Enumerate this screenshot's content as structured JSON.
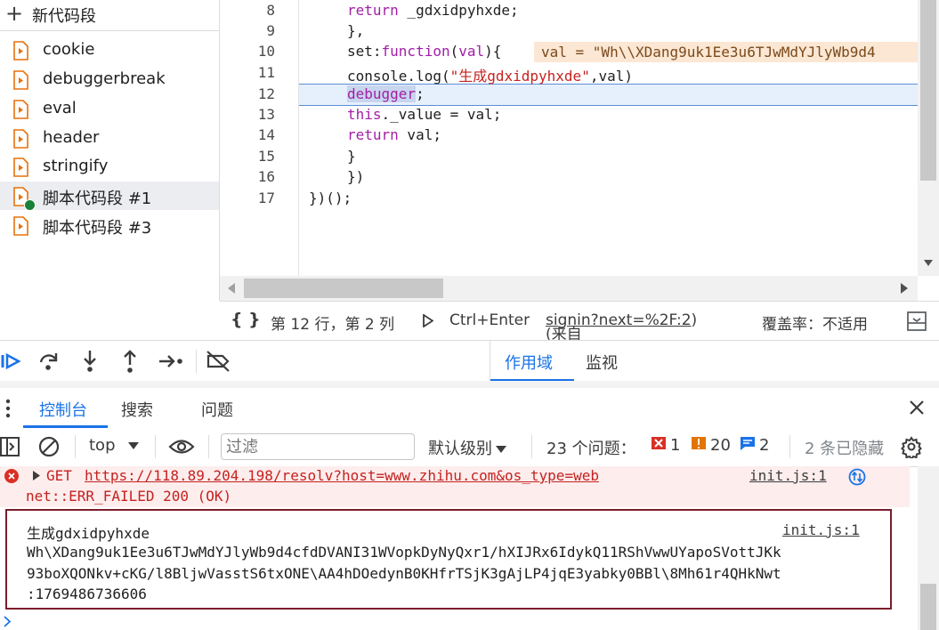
{
  "sidebar": {
    "new_snippet_label": "新代码段",
    "snippets": [
      {
        "label": "cookie"
      },
      {
        "label": "debuggerbreak"
      },
      {
        "label": "eval"
      },
      {
        "label": "header"
      },
      {
        "label": "stringify"
      },
      {
        "label": "脚本代码段 #1",
        "selected": true,
        "active_breakpoint": true
      },
      {
        "label": "脚本代码段 #3"
      }
    ]
  },
  "editor": {
    "line_numbers": [
      "8",
      "9",
      "10",
      "11",
      "12",
      "13",
      "14",
      "15",
      "16",
      "17"
    ],
    "lines": {
      "l8_kw": "return",
      "l8_rest": " _gdxidpyhxde;",
      "l9": "},",
      "l10_a": "set:",
      "l10_kw": "function",
      "l10_b": "(",
      "l10_param": "val",
      "l10_c": "){",
      "l10_inline": "val = \"Wh\\\\XDang9uk1Ee3u6TJwMdYJlyWb9d4",
      "l11_a": "console.log(",
      "l11_str": "\"生成gdxidpyhxde\"",
      "l11_b": ",val)",
      "l12_dbg": "debugger",
      "l12_rest": ";",
      "l13_kw": "this",
      "l13_rest": "._value = val;",
      "l14_kw": "return",
      "l14_rest": " val;",
      "l15": "}",
      "l16": "})",
      "l17": "})();"
    },
    "current_line": "12"
  },
  "status_bar": {
    "format_icon": "{ }",
    "position": "第 12 行，第 2 列",
    "run_shortcut": "Ctrl+Enter",
    "source_prefix": "(来自 ",
    "source_link": "signin?next=%2F:2",
    "source_suffix": ")",
    "coverage": "覆盖率：不适用"
  },
  "debug_toolbar": {
    "icons": [
      "resume-icon",
      "step-over-icon",
      "step-into-icon",
      "step-out-icon",
      "step-icon",
      "deactivate-breakpoints-icon"
    ]
  },
  "right_pane_tabs": [
    {
      "label": "作用域",
      "active": true
    },
    {
      "label": "监视",
      "active": false
    }
  ],
  "drawer_tabs": [
    {
      "label": "控制台",
      "active": true
    },
    {
      "label": "搜索",
      "active": false
    },
    {
      "label": "问题",
      "active": false
    }
  ],
  "console_toolbar": {
    "context": "top",
    "filter_placeholder": "过滤",
    "level": "默认级别",
    "issues_label": "23 个问题：",
    "errors_count": "1",
    "warnings_count": "20",
    "info_count": "2",
    "hidden_label": "2 条已隐藏"
  },
  "console_messages": {
    "error": {
      "method": "GET",
      "url": "https://118.89.204.198/resolv?host=www.zhihu.com&os_type=web",
      "detail": "net::ERR_FAILED 200 (OK)",
      "source": "init.js:1"
    },
    "log": {
      "prefix": "生成gdxidpyhxde",
      "source": "init.js:1",
      "value_lines": [
        "Wh\\XDang9uk1Ee3u6TJwMdYJlyWb9d4cfdDVANI31WVopkDyNyQxr1/hXIJRx6IdykQ11RShVwwUYapoSVottJKk",
        "93boXQONkv+cKG/l8BljwVasstS6txONE\\AA4hDOedynB0KHfrTSjK3gAjLP4jqE3yabky0BBl\\8Mh61r4QHkNwt",
        ":1769486736606"
      ]
    }
  },
  "colors": {
    "accent": "#1a73e8",
    "error": "#d93025",
    "warning": "#e37400",
    "keyword": "#a11fa6",
    "string": "#c5221f"
  }
}
